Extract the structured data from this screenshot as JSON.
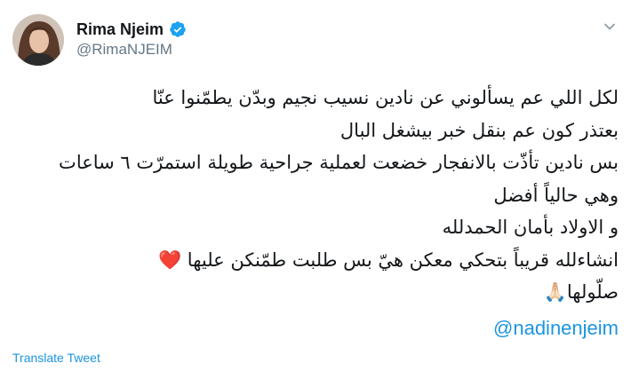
{
  "user": {
    "display_name": "Rima Njeim",
    "handle": "@RimaNJEIM"
  },
  "tweet": {
    "lines": [
      "لكل اللي عم يسألوني عن نادين نسيب نجيم وبدّن يطمّنوا عنّا",
      "بعتذر كون عم بنقل خبر بيشغل البال",
      "بس نادين تأذّت بالانفجار خضعت لعملية جراحية طويلة استمرّت ٦ ساعات",
      "وهي حالياً أفضل",
      "و الاولاد بأمان الحمدلله",
      "انشاءلله قريباً بتحكي معكن هيّ بس طلبت طمّنكن عليها ❤️",
      "صلّولها🙏🏻"
    ],
    "mention": "@nadinenjeim"
  },
  "translate_label": "Translate Tweet",
  "icons": {
    "verified": "verified-badge-icon",
    "caret": "chevron-down-icon",
    "heart": "red-heart-emoji",
    "pray": "folded-hands-emoji"
  },
  "colors": {
    "link": "#1b95e0",
    "handle": "#657786",
    "text": "#14171a",
    "heart": "#e0245e"
  }
}
